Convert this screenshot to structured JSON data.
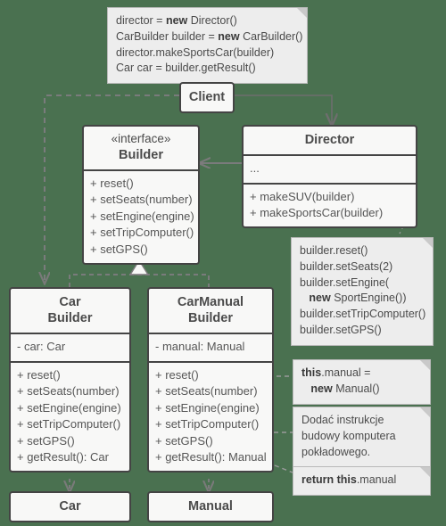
{
  "diagram": {
    "title": "Builder design pattern UML class diagram",
    "background_color": "#4a7150",
    "box_fill": "#f8f8f7",
    "box_border": "#444444",
    "note_fill": "#ededed",
    "note_border": "#b9b9b9",
    "line_color": "#7a7a7a",
    "text_color": "#4b4b4b"
  },
  "notes": {
    "client_code": {
      "name": "client-usage-note",
      "lines": [
        [
          {
            "t": "director = ",
            "b": false
          },
          {
            "t": "new",
            "b": true
          },
          {
            "t": " Director()",
            "b": false
          }
        ],
        [
          {
            "t": "CarBuilder builder = ",
            "b": false
          },
          {
            "t": "new",
            "b": true
          },
          {
            "t": " CarBuilder()",
            "b": false
          }
        ],
        [
          {
            "t": "director.makeSportsCar(builder)",
            "b": false
          }
        ],
        [
          {
            "t": "Car car = builder.getResult()",
            "b": false
          }
        ]
      ]
    },
    "make_sports_car": {
      "name": "make-sports-car-note",
      "lines": [
        [
          {
            "t": "builder.reset()",
            "b": false
          }
        ],
        [
          {
            "t": "builder.setSeats(2)",
            "b": false
          }
        ],
        [
          {
            "t": "builder.setEngine(",
            "b": false
          }
        ],
        [
          {
            "t": "   ",
            "b": false
          },
          {
            "t": "new",
            "b": true
          },
          {
            "t": " SportEngine())",
            "b": false
          }
        ],
        [
          {
            "t": "builder.setTripComputer()",
            "b": false
          }
        ],
        [
          {
            "t": "builder.setGPS()",
            "b": false
          }
        ]
      ]
    },
    "reset_note": {
      "name": "reset-implementation-note",
      "lines": [
        [
          {
            "t": "this",
            "b": true
          },
          {
            "t": ".manual =",
            "b": false
          }
        ],
        [
          {
            "t": "   ",
            "b": false
          },
          {
            "t": "new",
            "b": true
          },
          {
            "t": " Manual()",
            "b": false
          }
        ]
      ]
    },
    "trip_computer_note": {
      "name": "trip-computer-instruction-note",
      "lines": [
        [
          {
            "t": "Dodać instrukcje",
            "b": false
          }
        ],
        [
          {
            "t": "budowy komputera",
            "b": false
          }
        ],
        [
          {
            "t": "pokładowego.",
            "b": false
          }
        ]
      ]
    },
    "get_result_note": {
      "name": "get-result-implementation-note",
      "lines": [
        [
          {
            "t": "return this",
            "b": true
          },
          {
            "t": ".manual",
            "b": false
          }
        ]
      ]
    }
  },
  "classes": {
    "client": {
      "name": "client-class",
      "title": "Client",
      "stereotype": "",
      "attributes": [],
      "operations": []
    },
    "builder_interface": {
      "name": "builder-interface-class",
      "title": "Builder",
      "stereotype": "«interface»",
      "attributes": [],
      "operations": [
        "+ reset()",
        "+ setSeats(number)",
        "+ setEngine(engine)",
        "+ setTripComputer()",
        "+ setGPS()"
      ]
    },
    "director": {
      "name": "director-class",
      "title": "Director",
      "stereotype": "",
      "attributes": [
        "..."
      ],
      "operations": [
        "+ makeSUV(builder)",
        "+ makeSportsCar(builder)"
      ]
    },
    "car_builder": {
      "name": "car-builder-class",
      "title": "Car\nBuilder",
      "title_line1": "Car",
      "title_line2": "Builder",
      "stereotype": "",
      "attributes": [
        "- car: Car"
      ],
      "operations": [
        "+ reset()",
        "+ setSeats(number)",
        "+ setEngine(engine)",
        "+ setTripComputer()",
        "+ setGPS()",
        "+ getResult(): Car"
      ]
    },
    "car_manual_builder": {
      "name": "car-manual-builder-class",
      "title_line1": "CarManual",
      "title_line2": "Builder",
      "stereotype": "",
      "attributes": [
        "- manual: Manual"
      ],
      "operations": [
        "+ reset()",
        "+ setSeats(number)",
        "+ setEngine(engine)",
        "+ setTripComputer()",
        "+ setGPS()",
        "+ getResult(): Manual"
      ]
    },
    "car": {
      "name": "car-class",
      "title": "Car",
      "stereotype": "",
      "attributes": [],
      "operations": []
    },
    "manual": {
      "name": "manual-class",
      "title": "Manual",
      "stereotype": "",
      "attributes": [],
      "operations": []
    }
  },
  "relationships": [
    {
      "name": "client-to-director-association",
      "from": "client",
      "to": "director",
      "style": "solid",
      "arrow": "open"
    },
    {
      "name": "client-to-car-builder-dependency",
      "from": "client",
      "to": "car_builder",
      "style": "dashed",
      "arrow": "open"
    },
    {
      "name": "director-to-builder-association",
      "from": "director",
      "to": "builder_interface",
      "style": "solid",
      "arrow": "open"
    },
    {
      "name": "car-builder-realizes-builder",
      "from": "car_builder",
      "to": "builder_interface",
      "style": "dashed",
      "arrow": "hollow-triangle"
    },
    {
      "name": "car-manual-builder-realizes-builder",
      "from": "car_manual_builder",
      "to": "builder_interface",
      "style": "dashed",
      "arrow": "hollow-triangle"
    },
    {
      "name": "car-builder-creates-car",
      "from": "car_builder",
      "to": "car",
      "style": "dashed",
      "arrow": "open"
    },
    {
      "name": "car-manual-builder-creates-manual",
      "from": "car_manual_builder",
      "to": "manual",
      "style": "dashed",
      "arrow": "open"
    }
  ]
}
